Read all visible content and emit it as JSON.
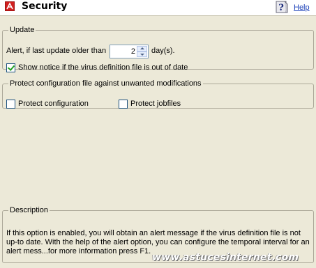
{
  "header": {
    "title": "Security",
    "help_label": "Help",
    "logo_icon": "avira-logo-icon",
    "help_icon": "help-question-icon"
  },
  "update": {
    "legend": "Update",
    "alert_label": "Alert, if last update older than",
    "days_value": "2",
    "days_unit": "day(s).",
    "notice_label": "Show notice if the virus definition file is out of date",
    "notice_checked": true
  },
  "protect": {
    "legend": "Protect configuration file against unwanted modifications",
    "protect_config_label": "Protect configuration",
    "protect_config_checked": false,
    "protect_jobfiles_label": "Protect jobfiles",
    "protect_jobfiles_checked": false
  },
  "description": {
    "legend": "Description",
    "text": "If this option is enabled, you will obtain an alert message if the virus definition file is not up-to date. With the help of the alert option, you can configure the temporal interval for an alert mess...for more information press F1."
  },
  "watermark": "www.astucesinternet.com",
  "colors": {
    "background": "#ece9d8",
    "header_bg": "#ffffff",
    "logo_red": "#d11f1f",
    "link_blue": "#1a3fb8"
  }
}
